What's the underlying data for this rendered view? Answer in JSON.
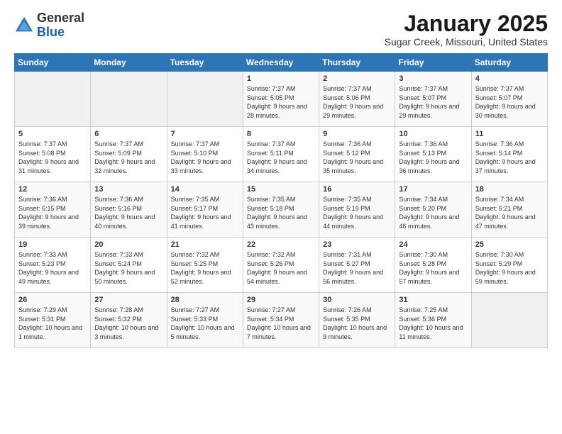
{
  "logo": {
    "general": "General",
    "blue": "Blue"
  },
  "header": {
    "month": "January 2025",
    "location": "Sugar Creek, Missouri, United States"
  },
  "weekdays": [
    "Sunday",
    "Monday",
    "Tuesday",
    "Wednesday",
    "Thursday",
    "Friday",
    "Saturday"
  ],
  "weeks": [
    [
      {
        "day": "",
        "empty": true
      },
      {
        "day": "",
        "empty": true
      },
      {
        "day": "",
        "empty": true
      },
      {
        "day": "1",
        "sunrise": "Sunrise: 7:37 AM",
        "sunset": "Sunset: 5:05 PM",
        "daylight": "Daylight: 9 hours and 28 minutes."
      },
      {
        "day": "2",
        "sunrise": "Sunrise: 7:37 AM",
        "sunset": "Sunset: 5:06 PM",
        "daylight": "Daylight: 9 hours and 29 minutes."
      },
      {
        "day": "3",
        "sunrise": "Sunrise: 7:37 AM",
        "sunset": "Sunset: 5:07 PM",
        "daylight": "Daylight: 9 hours and 29 minutes."
      },
      {
        "day": "4",
        "sunrise": "Sunrise: 7:37 AM",
        "sunset": "Sunset: 5:07 PM",
        "daylight": "Daylight: 9 hours and 30 minutes."
      }
    ],
    [
      {
        "day": "5",
        "sunrise": "Sunrise: 7:37 AM",
        "sunset": "Sunset: 5:08 PM",
        "daylight": "Daylight: 9 hours and 31 minutes."
      },
      {
        "day": "6",
        "sunrise": "Sunrise: 7:37 AM",
        "sunset": "Sunset: 5:09 PM",
        "daylight": "Daylight: 9 hours and 32 minutes."
      },
      {
        "day": "7",
        "sunrise": "Sunrise: 7:37 AM",
        "sunset": "Sunset: 5:10 PM",
        "daylight": "Daylight: 9 hours and 33 minutes."
      },
      {
        "day": "8",
        "sunrise": "Sunrise: 7:37 AM",
        "sunset": "Sunset: 5:11 PM",
        "daylight": "Daylight: 9 hours and 34 minutes."
      },
      {
        "day": "9",
        "sunrise": "Sunrise: 7:36 AM",
        "sunset": "Sunset: 5:12 PM",
        "daylight": "Daylight: 9 hours and 35 minutes."
      },
      {
        "day": "10",
        "sunrise": "Sunrise: 7:36 AM",
        "sunset": "Sunset: 5:13 PM",
        "daylight": "Daylight: 9 hours and 36 minutes."
      },
      {
        "day": "11",
        "sunrise": "Sunrise: 7:36 AM",
        "sunset": "Sunset: 5:14 PM",
        "daylight": "Daylight: 9 hours and 37 minutes."
      }
    ],
    [
      {
        "day": "12",
        "sunrise": "Sunrise: 7:36 AM",
        "sunset": "Sunset: 5:15 PM",
        "daylight": "Daylight: 9 hours and 39 minutes."
      },
      {
        "day": "13",
        "sunrise": "Sunrise: 7:36 AM",
        "sunset": "Sunset: 5:16 PM",
        "daylight": "Daylight: 9 hours and 40 minutes."
      },
      {
        "day": "14",
        "sunrise": "Sunrise: 7:35 AM",
        "sunset": "Sunset: 5:17 PM",
        "daylight": "Daylight: 9 hours and 41 minutes."
      },
      {
        "day": "15",
        "sunrise": "Sunrise: 7:35 AM",
        "sunset": "Sunset: 5:18 PM",
        "daylight": "Daylight: 9 hours and 43 minutes."
      },
      {
        "day": "16",
        "sunrise": "Sunrise: 7:35 AM",
        "sunset": "Sunset: 5:19 PM",
        "daylight": "Daylight: 9 hours and 44 minutes."
      },
      {
        "day": "17",
        "sunrise": "Sunrise: 7:34 AM",
        "sunset": "Sunset: 5:20 PM",
        "daylight": "Daylight: 9 hours and 46 minutes."
      },
      {
        "day": "18",
        "sunrise": "Sunrise: 7:34 AM",
        "sunset": "Sunset: 5:21 PM",
        "daylight": "Daylight: 9 hours and 47 minutes."
      }
    ],
    [
      {
        "day": "19",
        "sunrise": "Sunrise: 7:33 AM",
        "sunset": "Sunset: 5:23 PM",
        "daylight": "Daylight: 9 hours and 49 minutes."
      },
      {
        "day": "20",
        "sunrise": "Sunrise: 7:33 AM",
        "sunset": "Sunset: 5:24 PM",
        "daylight": "Daylight: 9 hours and 50 minutes."
      },
      {
        "day": "21",
        "sunrise": "Sunrise: 7:32 AM",
        "sunset": "Sunset: 5:25 PM",
        "daylight": "Daylight: 9 hours and 52 minutes."
      },
      {
        "day": "22",
        "sunrise": "Sunrise: 7:32 AM",
        "sunset": "Sunset: 5:26 PM",
        "daylight": "Daylight: 9 hours and 54 minutes."
      },
      {
        "day": "23",
        "sunrise": "Sunrise: 7:31 AM",
        "sunset": "Sunset: 5:27 PM",
        "daylight": "Daylight: 9 hours and 56 minutes."
      },
      {
        "day": "24",
        "sunrise": "Sunrise: 7:30 AM",
        "sunset": "Sunset: 5:28 PM",
        "daylight": "Daylight: 9 hours and 57 minutes."
      },
      {
        "day": "25",
        "sunrise": "Sunrise: 7:30 AM",
        "sunset": "Sunset: 5:29 PM",
        "daylight": "Daylight: 9 hours and 59 minutes."
      }
    ],
    [
      {
        "day": "26",
        "sunrise": "Sunrise: 7:29 AM",
        "sunset": "Sunset: 5:31 PM",
        "daylight": "Daylight: 10 hours and 1 minute."
      },
      {
        "day": "27",
        "sunrise": "Sunrise: 7:28 AM",
        "sunset": "Sunset: 5:32 PM",
        "daylight": "Daylight: 10 hours and 3 minutes."
      },
      {
        "day": "28",
        "sunrise": "Sunrise: 7:27 AM",
        "sunset": "Sunset: 5:33 PM",
        "daylight": "Daylight: 10 hours and 5 minutes."
      },
      {
        "day": "29",
        "sunrise": "Sunrise: 7:27 AM",
        "sunset": "Sunset: 5:34 PM",
        "daylight": "Daylight: 10 hours and 7 minutes."
      },
      {
        "day": "30",
        "sunrise": "Sunrise: 7:26 AM",
        "sunset": "Sunset: 5:35 PM",
        "daylight": "Daylight: 10 hours and 9 minutes."
      },
      {
        "day": "31",
        "sunrise": "Sunrise: 7:25 AM",
        "sunset": "Sunset: 5:36 PM",
        "daylight": "Daylight: 10 hours and 11 minutes."
      },
      {
        "day": "",
        "empty": true
      }
    ]
  ]
}
